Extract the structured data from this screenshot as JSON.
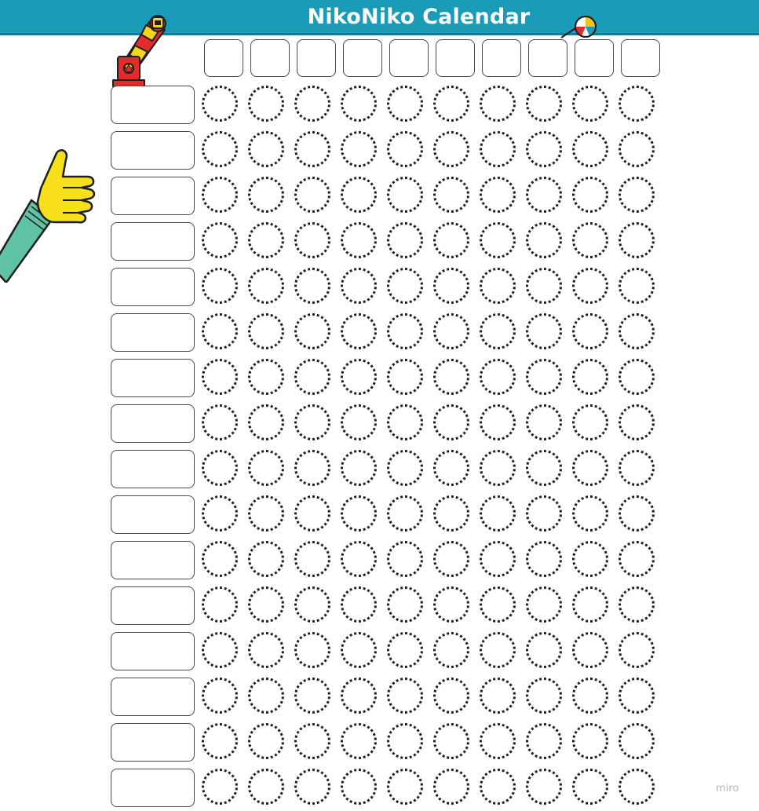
{
  "header": {
    "title": "NikoNiko Calendar"
  },
  "grid": {
    "day_columns": 10,
    "member_rows": 16
  },
  "colors": {
    "header_bar": "#1a9cb8",
    "circle_border": "#1f1f1f",
    "box_border": "#4a4a4a"
  },
  "icons": {
    "cannon": "cannon-icon",
    "beach_ball": "beach-ball-icon",
    "thumbs_up": "thumbs-up-icon"
  },
  "watermark": {
    "text": "miro"
  }
}
